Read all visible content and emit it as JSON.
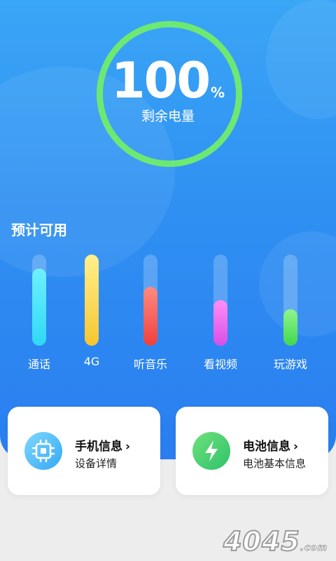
{
  "battery": {
    "percent": "100",
    "unit": "%",
    "label": "剩余电量",
    "ring_color": "#6de873"
  },
  "estimate": {
    "title": "预计可用",
    "bars": [
      {
        "label": "通话",
        "fill": 0.85,
        "colors": [
          "#6ff0ff",
          "#2fd8f6"
        ]
      },
      {
        "label": "4G",
        "fill": 1.0,
        "colors": [
          "#fff08c",
          "#f6c630"
        ]
      },
      {
        "label": "听音乐",
        "fill": 0.65,
        "colors": [
          "#ff8a80",
          "#f0403c"
        ]
      },
      {
        "label": "看视频",
        "fill": 0.5,
        "colors": [
          "#ff8ff6",
          "#d94ee6"
        ]
      },
      {
        "label": "玩游戏",
        "fill": 0.4,
        "colors": [
          "#8ff58c",
          "#42d84e"
        ]
      }
    ]
  },
  "cards": [
    {
      "title": "手机信息",
      "chevron": "›",
      "subtitle": "设备详情",
      "icon": "chip-icon",
      "colors": [
        "#7ed8ff",
        "#35a8f4"
      ]
    },
    {
      "title": "电池信息",
      "chevron": "›",
      "subtitle": "电池基本信息",
      "icon": "lightning-icon",
      "colors": [
        "#6fe07c",
        "#2ec36a"
      ]
    }
  ],
  "watermark": {
    "text": "4045",
    "suffix": ".com"
  }
}
